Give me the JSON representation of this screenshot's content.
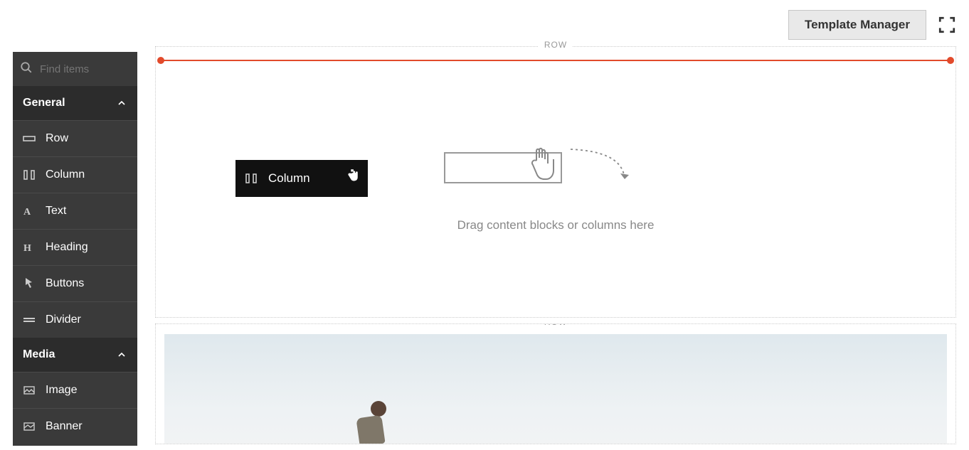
{
  "header": {
    "template_manager_label": "Template Manager"
  },
  "sidebar": {
    "search_placeholder": "Find items",
    "sections": [
      {
        "label": "General"
      },
      {
        "label": "Media"
      }
    ],
    "general_items": [
      {
        "label": "Row",
        "icon": "row-icon"
      },
      {
        "label": "Column",
        "icon": "column-icon"
      },
      {
        "label": "Text",
        "icon": "text-icon"
      },
      {
        "label": "Heading",
        "icon": "heading-icon"
      },
      {
        "label": "Buttons",
        "icon": "buttons-icon"
      },
      {
        "label": "Divider",
        "icon": "divider-icon"
      }
    ],
    "media_items": [
      {
        "label": "Image",
        "icon": "image-icon"
      },
      {
        "label": "Banner",
        "icon": "banner-icon"
      }
    ]
  },
  "canvas": {
    "row_label": "ROW",
    "drop_hint": "Drag content blocks or columns here",
    "dragged_item_label": "Column"
  }
}
